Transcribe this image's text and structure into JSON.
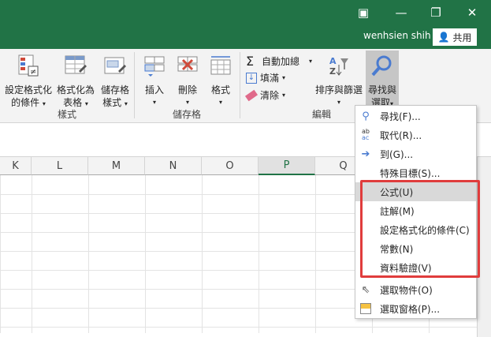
{
  "window": {
    "user": "wenhsien shih",
    "share_label": "共用"
  },
  "ribbon": {
    "styles_group": "樣式",
    "cells_group": "儲存格",
    "edit_group": "編輯",
    "cond_format": [
      "設定格式化",
      "的條件"
    ],
    "format_table": [
      "格式化為",
      "表格"
    ],
    "cell_styles": [
      "儲存格",
      "樣式"
    ],
    "insert": "插入",
    "delete": "刪除",
    "format": "格式",
    "autosum": "自動加總",
    "fill": "填滿",
    "clear": "清除",
    "sort_filter": "排序與篩選",
    "find_select": [
      "尋找與",
      "選取"
    ]
  },
  "columns": [
    "K",
    "L",
    "M",
    "N",
    "O",
    "P",
    "Q"
  ],
  "selected_column": "P",
  "menu": {
    "items": [
      {
        "label": "尋找(F)...",
        "icon": "search-icon"
      },
      {
        "label": "取代(R)...",
        "icon": "replace-icon"
      },
      {
        "label": "到(G)...",
        "icon": "arrow-right-icon"
      },
      {
        "label": "特殊目標(S)...",
        "icon": ""
      },
      {
        "label": "公式(U)",
        "icon": ""
      },
      {
        "label": "註解(M)",
        "icon": ""
      },
      {
        "label": "設定格式化的條件(C)",
        "icon": ""
      },
      {
        "label": "常數(N)",
        "icon": ""
      },
      {
        "label": "資料驗證(V)",
        "icon": ""
      },
      {
        "label": "選取物件(O)",
        "icon": "cursor-icon"
      },
      {
        "label": "選取窗格(P)...",
        "icon": "selection-pane-icon"
      }
    ],
    "highlighted_index": 4
  },
  "colors": {
    "titlebar": "#217346",
    "highlight_box": "#e03c3c"
  }
}
